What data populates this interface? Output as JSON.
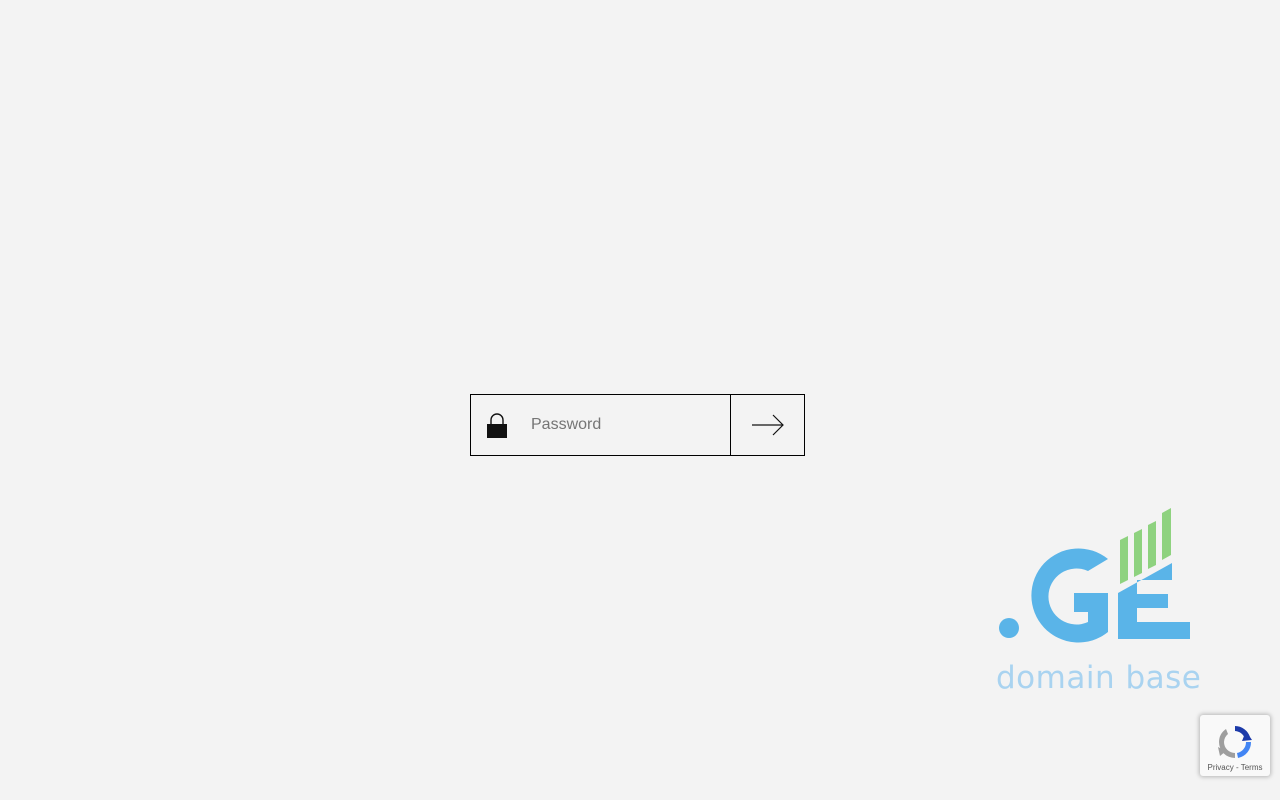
{
  "login": {
    "password_placeholder": "Password",
    "password_value": "",
    "lock_icon": "lock-icon",
    "submit_icon": "arrow-right-icon"
  },
  "brand": {
    "logo_text": ".GE",
    "tagline": "domain base",
    "colors": {
      "blue": "#5ab4e8",
      "green": "#8ed27f",
      "tagline": "#a9d3f0"
    }
  },
  "recaptcha": {
    "privacy_label": "Privacy",
    "separator": " - ",
    "terms_label": "Terms"
  }
}
